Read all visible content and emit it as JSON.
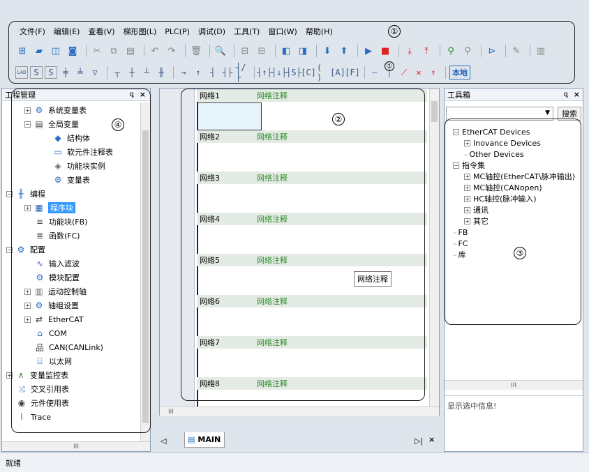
{
  "menu": [
    "文件(F)",
    "编辑(E)",
    "查看(V)",
    "梯形图(L)",
    "PLC(P)",
    "调试(D)",
    "工具(T)",
    "窗口(W)",
    "帮助(H)"
  ],
  "annotations": {
    "one": "①",
    "two": "②",
    "three": "③",
    "four": "④"
  },
  "project_panel": {
    "title": "工程管理",
    "pin": "ꝗ",
    "close": "×"
  },
  "project_tree": [
    {
      "label": "系统变量表",
      "indent": 0,
      "toggle": "+",
      "icon": "gear"
    },
    {
      "label": "全局变量",
      "indent": 0,
      "toggle": "-",
      "icon": "doc"
    },
    {
      "label": "结构体",
      "indent": 1,
      "icon": "struct"
    },
    {
      "label": "软元件注释表",
      "indent": 1,
      "icon": "comment"
    },
    {
      "label": "功能块实例",
      "indent": 1,
      "icon": "box"
    },
    {
      "label": "变量表",
      "indent": 1,
      "icon": "gear"
    },
    {
      "label": "编程",
      "indent": -1,
      "toggle": "-",
      "icon": "ladder"
    },
    {
      "label": "程序块",
      "indent": 0,
      "toggle": "+",
      "icon": "grid",
      "selected": true
    },
    {
      "label": "功能块(FB)",
      "indent": 0,
      "icon": "fb"
    },
    {
      "label": "函数(FC)",
      "indent": 0,
      "icon": "fc"
    },
    {
      "label": "配置",
      "indent": -1,
      "toggle": "-",
      "icon": "config"
    },
    {
      "label": "输入滤波",
      "indent": 0,
      "icon": "wave"
    },
    {
      "label": "模块配置",
      "indent": 0,
      "icon": "module"
    },
    {
      "label": "运动控制轴",
      "indent": 0,
      "toggle": "+",
      "icon": "axis"
    },
    {
      "label": "轴组设置",
      "indent": 0,
      "toggle": "+",
      "icon": "gear"
    },
    {
      "label": "EtherCAT",
      "indent": 0,
      "toggle": "+",
      "icon": "ecat"
    },
    {
      "label": "COM",
      "indent": 0,
      "icon": "com"
    },
    {
      "label": "CAN(CANLink)",
      "indent": 0,
      "icon": "can"
    },
    {
      "label": "以太网",
      "indent": 0,
      "icon": "eth"
    },
    {
      "label": "变量监控表",
      "indent": -1,
      "toggle": "+",
      "icon": "monitor"
    },
    {
      "label": "交叉引用表",
      "indent": -1,
      "icon": "cross"
    },
    {
      "label": "元件使用表",
      "indent": -1,
      "icon": "db"
    },
    {
      "label": "Trace",
      "indent": -1,
      "icon": "trace"
    }
  ],
  "editor": {
    "networks": [
      {
        "name": "网络1",
        "comment": "网络注释"
      },
      {
        "name": "网络2",
        "comment": "网络注释"
      },
      {
        "name": "网络3",
        "comment": "网络注释"
      },
      {
        "name": "网络4",
        "comment": "网络注释"
      },
      {
        "name": "网络5",
        "comment": "网络注释"
      },
      {
        "name": "网络6",
        "comment": "网络注释"
      },
      {
        "name": "网络7",
        "comment": "网络注释"
      },
      {
        "name": "网络8",
        "comment": "网络注释"
      }
    ],
    "tooltip": "网络注释",
    "tab": "MAIN",
    "hscroll": "III"
  },
  "toolbox": {
    "title": "工具箱",
    "search_button": "搜索",
    "tree": [
      {
        "label": "EtherCAT Devices",
        "indent": 0,
        "toggle": "-"
      },
      {
        "label": "Inovance Devices",
        "indent": 1,
        "toggle": "+"
      },
      {
        "label": "Other Devices",
        "indent": 1
      },
      {
        "label": "指令集",
        "indent": 0,
        "toggle": "-"
      },
      {
        "label": "MC轴控(EtherCAT\\脉冲输出)",
        "indent": 1,
        "toggle": "+"
      },
      {
        "label": "MC轴控(CANopen)",
        "indent": 1,
        "toggle": "+"
      },
      {
        "label": "HC轴控(脉冲输入)",
        "indent": 1,
        "toggle": "+"
      },
      {
        "label": "通讯",
        "indent": 1,
        "toggle": "+"
      },
      {
        "label": "其它",
        "indent": 1,
        "toggle": "+"
      },
      {
        "label": "FB",
        "indent": 0
      },
      {
        "label": "FC",
        "indent": 0
      },
      {
        "label": "库",
        "indent": 0
      }
    ],
    "info": "显示选中信息!",
    "hscroll": "III"
  },
  "status": "就绪",
  "toolbar2_right": "本地"
}
